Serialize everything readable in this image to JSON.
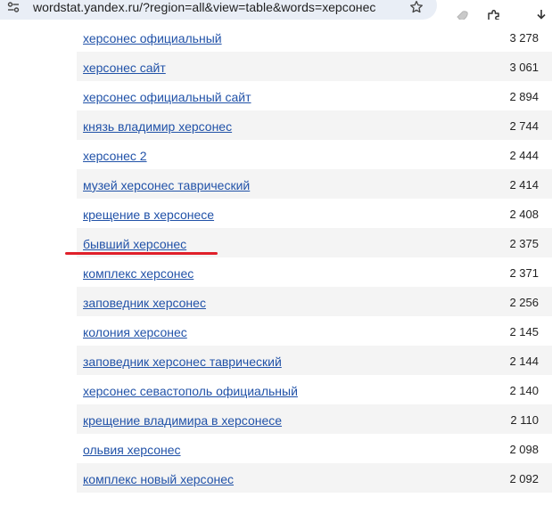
{
  "browser": {
    "url": "wordstat.yandex.ru/?region=all&view=table&words=херсонес",
    "icons": [
      "tune-icon",
      "star-icon",
      "rocket-extension-icon",
      "puzzle-icon",
      "download-icon"
    ]
  },
  "table": {
    "rows": [
      {
        "phrase": "херсонес официальный",
        "count": "3 278"
      },
      {
        "phrase": "херсонес сайт",
        "count": "3 061"
      },
      {
        "phrase": "херсонес официальный сайт",
        "count": "2 894"
      },
      {
        "phrase": "князь владимир херсонес",
        "count": "2 744"
      },
      {
        "phrase": "херсонес 2",
        "count": "2 444"
      },
      {
        "phrase": "музей херсонес таврический",
        "count": "2 414"
      },
      {
        "phrase": "крещение в херсонесе",
        "count": "2 408"
      },
      {
        "phrase": "бывший херсонес",
        "count": "2 375"
      },
      {
        "phrase": "комплекс херсонес",
        "count": "2 371"
      },
      {
        "phrase": "заповедник херсонес",
        "count": "2 256"
      },
      {
        "phrase": "колония херсонес",
        "count": "2 145"
      },
      {
        "phrase": "заповедник херсонес таврический",
        "count": "2 144"
      },
      {
        "phrase": "херсонес севастополь официальный",
        "count": "2 140"
      },
      {
        "phrase": "крещение владимира в херсонесе",
        "count": "2 110"
      },
      {
        "phrase": "ольвия херсонес",
        "count": "2 098"
      },
      {
        "phrase": "комплекс новый херсонес",
        "count": "2 092"
      },
      {
        "phrase": "",
        "count": ""
      }
    ]
  },
  "annotation": {
    "color": "#e0202a",
    "marks": "бывший херсонес"
  }
}
